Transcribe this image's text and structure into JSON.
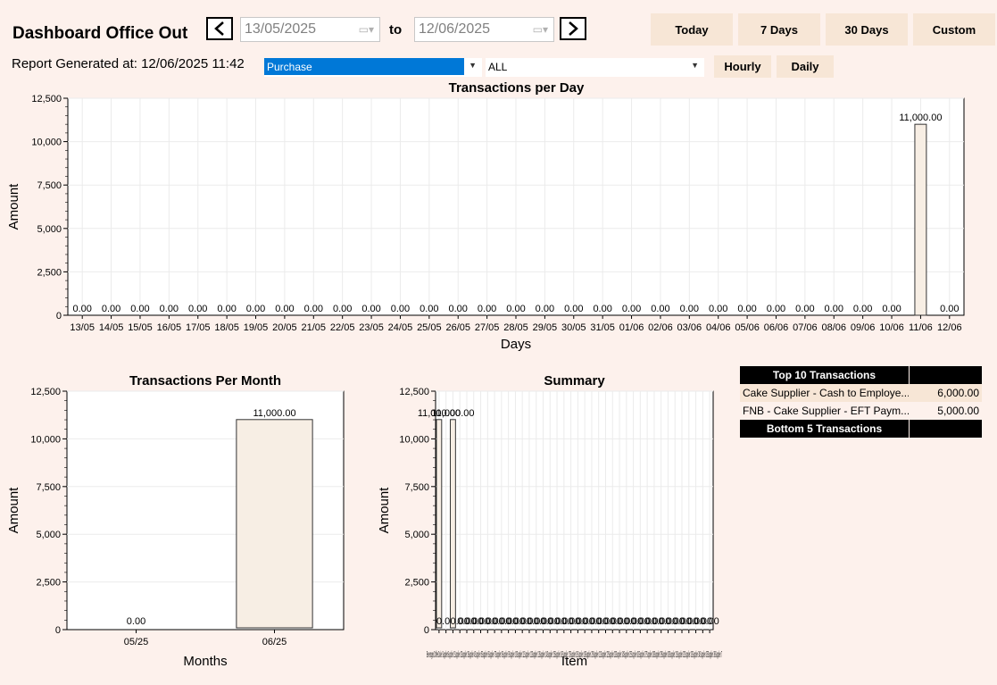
{
  "header": {
    "title": "Dashboard Office Out",
    "generated": "Report Generated at: 12/06/2025 11:42",
    "prev_icon": "chevron-left-icon",
    "next_icon": "chevron-right-icon",
    "from_date": "13/05/2025",
    "to_label": "to",
    "to_date": "12/06/2025"
  },
  "range_buttons": [
    "Today",
    "7 Days",
    "30 Days",
    "Custom"
  ],
  "filters": {
    "type_value": "Purchase",
    "category_value": "ALL",
    "hourly_label": "Hourly",
    "daily_label": "Daily"
  },
  "colors": {
    "background": "#fdf1ec",
    "bar_fill": "#f7eee4",
    "selected_highlight": "#0078d7",
    "button_bg": "#f7e6d6"
  },
  "chart_data": [
    {
      "type": "bar",
      "title": "Transactions per Day",
      "xlabel": "Days",
      "ylabel": "Amount",
      "ylim": [
        0,
        12500
      ],
      "yticks": [
        "0",
        "2,500",
        "5,000",
        "7,500",
        "10,000",
        "12,500"
      ],
      "categories": [
        "13/05",
        "14/05",
        "15/05",
        "16/05",
        "17/05",
        "18/05",
        "19/05",
        "20/05",
        "21/05",
        "22/05",
        "23/05",
        "24/05",
        "25/05",
        "26/05",
        "27/05",
        "28/05",
        "29/05",
        "30/05",
        "31/05",
        "01/06",
        "02/06",
        "03/06",
        "04/06",
        "05/06",
        "06/06",
        "07/06",
        "08/06",
        "09/06",
        "10/06",
        "11/06",
        "12/06"
      ],
      "values": [
        0,
        0,
        0,
        0,
        0,
        0,
        0,
        0,
        0,
        0,
        0,
        0,
        0,
        0,
        0,
        0,
        0,
        0,
        0,
        0,
        0,
        0,
        0,
        0,
        0,
        0,
        0,
        0,
        0,
        11000,
        0
      ],
      "labels": [
        "0.00",
        "0.00",
        "0.00",
        "0.00",
        "0.00",
        "0.00",
        "0.00",
        "0.00",
        "0.00",
        "0.00",
        "0.00",
        "0.00",
        "0.00",
        "0.00",
        "0.00",
        "0.00",
        "0.00",
        "0.00",
        "0.00",
        "0.00",
        "0.00",
        "0.00",
        "0.00",
        "0.00",
        "0.00",
        "0.00",
        "0.00",
        "0.00",
        "0.00",
        "11,000.00",
        "0.00"
      ],
      "grid": true
    },
    {
      "type": "bar",
      "title": "Transactions Per Month",
      "xlabel": "Months",
      "ylabel": "Amount",
      "ylim": [
        0,
        12500
      ],
      "yticks": [
        "0",
        "2,500",
        "5,000",
        "7,500",
        "10,000",
        "12,500"
      ],
      "categories": [
        "05/25",
        "06/25"
      ],
      "values": [
        0,
        11000
      ],
      "labels": [
        "0.00",
        "11,000.00"
      ],
      "grid": true
    },
    {
      "type": "bar",
      "title": "Summary",
      "xlabel": "Item",
      "ylabel": "Amount",
      "ylim": [
        0,
        12500
      ],
      "yticks": [
        "0",
        "2,500",
        "5,000",
        "7,500",
        "10,000",
        "12,500"
      ],
      "categories": [
        "Beverages",
        "Coffee",
        "Cake Supplier",
        "Supplier 1",
        "Supplier 2",
        "Supplier 3",
        "Supplier 4",
        "Supplier 5",
        "Supplier 6",
        "Supplier 7",
        "Supplier 8",
        "Supplier 9",
        "Supplier 10",
        "Supplier 11",
        "Supplier 12",
        "Supplier 13",
        "Supplier 14",
        "Supplier 15",
        "Supplier 16",
        "Supplier 17",
        "Supplier 18",
        "Supplier 19",
        "Supplier 20",
        "Supplier 21",
        "Supplier 22",
        "Supplier 23",
        "Supplier 24",
        "Supplier 25",
        "Supplier 26",
        "Supplier 27",
        "Supplier 28",
        "Supplier 29",
        "Supplier 30",
        "Supplier 31",
        "Supplier 32",
        "Supplier 33",
        "Supplier 34",
        "Supplier 35",
        "Supplier 36",
        "Supplier 7"
      ],
      "values": [
        11000,
        0,
        11000,
        0,
        0,
        0,
        0,
        0,
        0,
        0,
        0,
        0,
        0,
        0,
        0,
        0,
        0,
        0,
        0,
        0,
        0,
        0,
        0,
        0,
        0,
        0,
        0,
        0,
        0,
        0,
        0,
        0,
        0,
        0,
        0,
        0,
        0,
        0,
        0,
        0
      ],
      "value_label_zero": "0.00",
      "value_label_max": "11,000.00",
      "grid": true
    }
  ],
  "top_table": {
    "top_header": "Top 10 Transactions",
    "rows": [
      {
        "desc": "Cake Supplier - Cash to Employe...",
        "amount": "6,000.00"
      },
      {
        "desc": "FNB - Cake Supplier - EFT Paym...",
        "amount": "5,000.00"
      }
    ],
    "bottom_header": "Bottom 5 Transactions"
  }
}
